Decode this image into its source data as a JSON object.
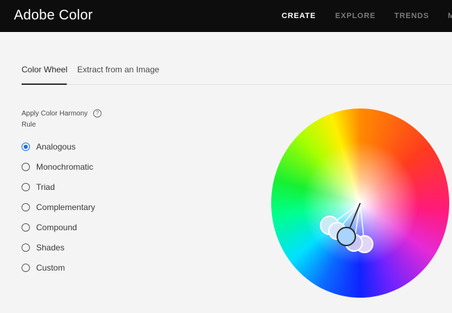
{
  "app": {
    "title": "Adobe Color"
  },
  "nav": {
    "items": [
      {
        "label": "CREATE"
      },
      {
        "label": "EXPLORE"
      },
      {
        "label": "TRENDS"
      },
      {
        "label": "M"
      }
    ]
  },
  "tabs": [
    {
      "label": "Color Wheel"
    },
    {
      "label": "Extract from an Image"
    }
  ],
  "harmony": {
    "label": "Apply Color Harmony Rule",
    "help_icon": "?"
  },
  "rules": [
    {
      "label": "Analogous",
      "selected": true
    },
    {
      "label": "Monochromatic",
      "selected": false
    },
    {
      "label": "Triad",
      "selected": false
    },
    {
      "label": "Complementary",
      "selected": false
    },
    {
      "label": "Compound",
      "selected": false
    },
    {
      "label": "Shades",
      "selected": false
    },
    {
      "label": "Custom",
      "selected": false
    }
  ],
  "colors": {
    "accent": "#1473e6",
    "base_handle": "#a9d4ff",
    "secondary_handles": [
      "#c8ecf6",
      "#d8e6f7",
      "#c9c8f5",
      "#e2d6f7"
    ]
  }
}
